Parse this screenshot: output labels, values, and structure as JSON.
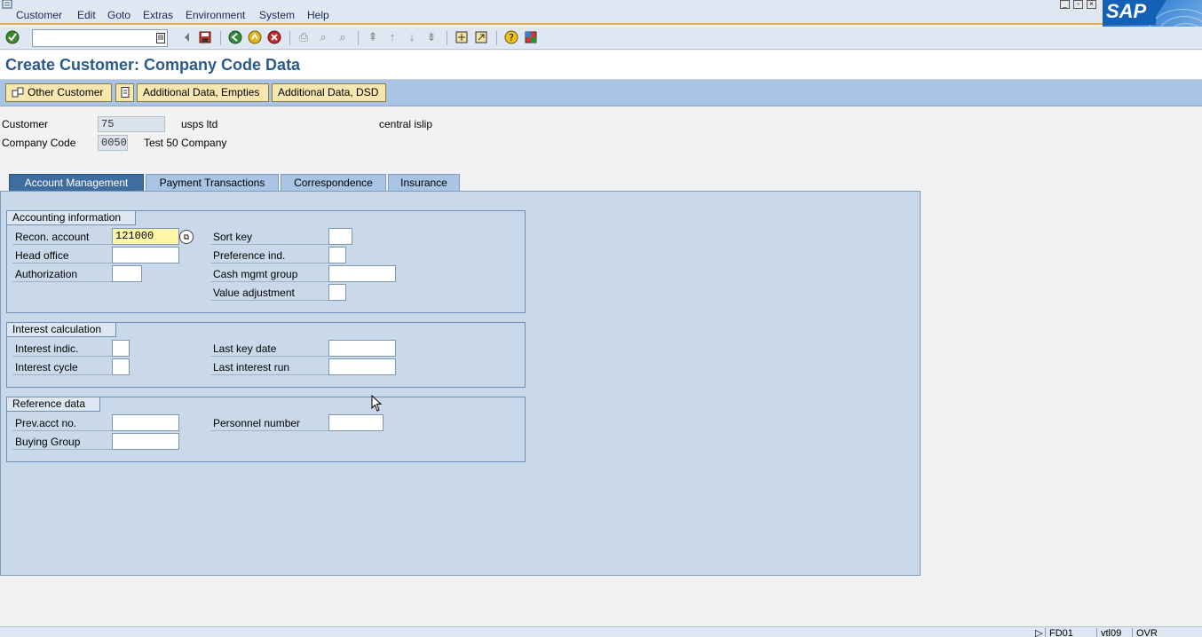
{
  "menu": {
    "items": [
      "Customer",
      "Edit",
      "Goto",
      "Extras",
      "Environment",
      "System",
      "Help"
    ]
  },
  "brand": {
    "logo_text": "SAP",
    "accent": "#e8a94a",
    "title_color": "#2a5a8e"
  },
  "toolbar": {
    "command_field": {
      "value": "",
      "placeholder": ""
    },
    "icons": [
      "enter-icon",
      "back-icon",
      "save-icon",
      "green-back-icon",
      "exit-icon",
      "cancel-icon",
      "print-icon",
      "find-icon",
      "find-next-icon",
      "first-page-icon",
      "previous-page-icon",
      "next-page-icon",
      "last-page-icon",
      "create-session-icon",
      "shortcut-icon",
      "help-icon",
      "layout-icon"
    ]
  },
  "page": {
    "title": "Create Customer: Company Code Data"
  },
  "app_toolbar": {
    "other_customer": "Other Customer",
    "additional_empties": "Additional Data, Empties",
    "additional_dsd": "Additional Data, DSD"
  },
  "header": {
    "customer_label": "Customer",
    "customer_value": "75",
    "customer_name": "usps ltd",
    "customer_city": "central islip",
    "company_code_label": "Company Code",
    "company_code_value": "0050",
    "company_name": "Test 50 Company"
  },
  "tabs": [
    {
      "label": "Account Management",
      "active": true
    },
    {
      "label": "Payment Transactions",
      "active": false
    },
    {
      "label": "Correspondence",
      "active": false
    },
    {
      "label": "Insurance",
      "active": false
    }
  ],
  "accounting": {
    "title": "Accounting information",
    "recon_account_label": "Recon. account",
    "recon_account_value": "121000",
    "head_office_label": "Head office",
    "head_office_value": "",
    "authorization_label": "Authorization",
    "authorization_value": "",
    "sort_key_label": "Sort key",
    "sort_key_value": "",
    "preference_label": "Preference ind.",
    "preference_value": "",
    "cash_mgmt_label": "Cash mgmt group",
    "cash_mgmt_value": "",
    "value_adj_label": "Value adjustment",
    "value_adj_value": ""
  },
  "interest": {
    "title": "Interest calculation",
    "indic_label": "Interest indic.",
    "indic_value": "",
    "cycle_label": "Interest cycle",
    "cycle_value": "",
    "last_key_label": "Last key date",
    "last_key_value": "",
    "last_run_label": "Last interest run",
    "last_run_value": ""
  },
  "reference": {
    "title": "Reference data",
    "prev_acct_label": "Prev.acct no.",
    "prev_acct_value": "",
    "buying_group_label": "Buying Group",
    "buying_group_value": "",
    "personnel_label": "Personnel number",
    "personnel_value": ""
  },
  "status": {
    "transaction": "FD01",
    "system": "vtl09",
    "mode": "OVR"
  }
}
